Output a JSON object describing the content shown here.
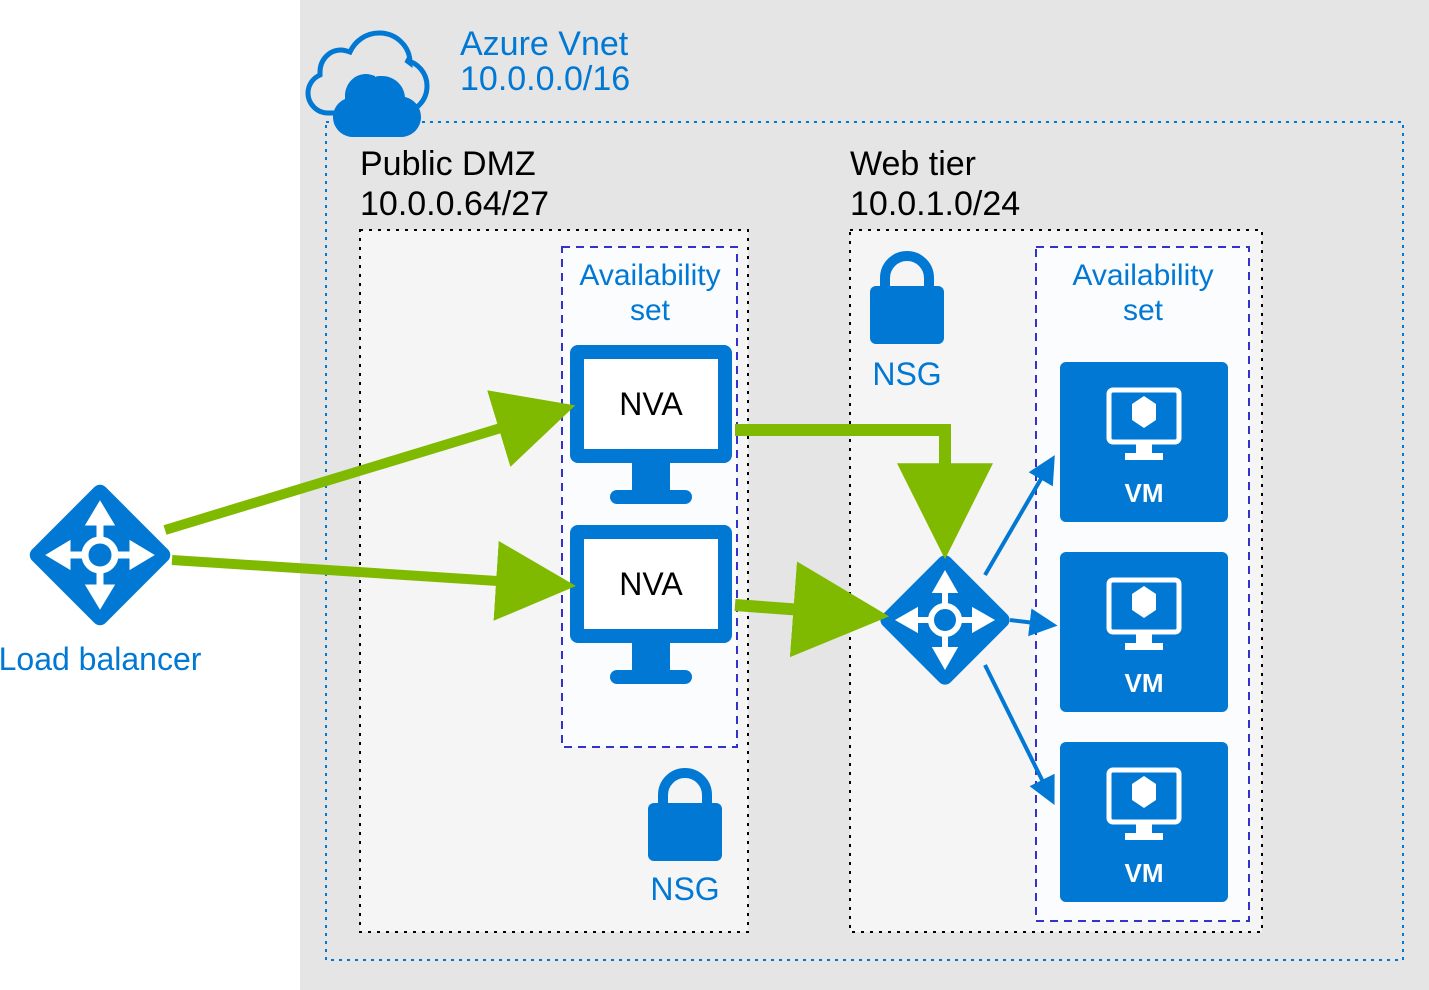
{
  "colors": {
    "azure": "#0078D4",
    "arrowGreen": "#7FBA00",
    "arrowBlue": "#0078D4",
    "text": "#000",
    "blueText": "#0078D4",
    "greyBg": "#E5E5E5",
    "innerBg": "#F5F5F5",
    "white": "#FFFFFF"
  },
  "vnet": {
    "title": "Azure Vnet",
    "cidr": "10.0.0.0/16"
  },
  "subnets": {
    "dmz": {
      "title": "Public DMZ",
      "cidr": "10.0.0.64/27",
      "availability": "Availability set",
      "nva": "NVA",
      "nsg": "NSG"
    },
    "web": {
      "title": "Web tier",
      "cidr": "10.0.1.0/24",
      "availability": "Availability set",
      "vm": "VM",
      "nsg": "NSG"
    }
  },
  "lb": {
    "label": "Load balancer"
  }
}
